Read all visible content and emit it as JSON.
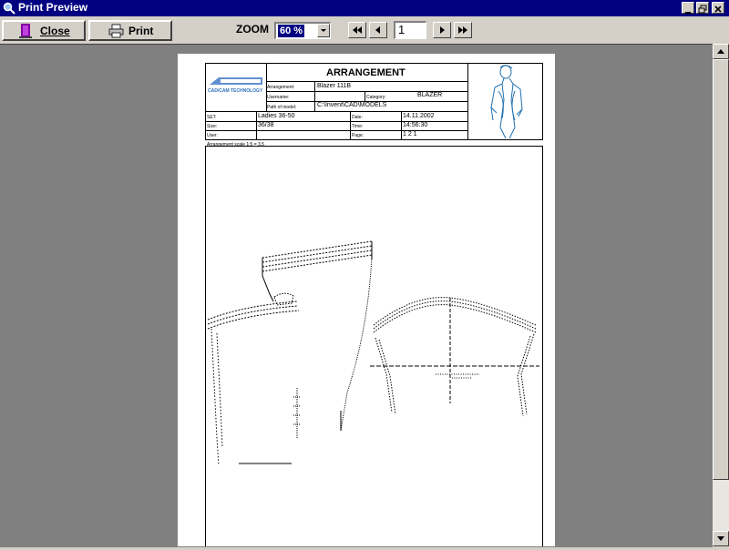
{
  "window": {
    "title": "Print Preview"
  },
  "toolbar": {
    "close_label": "Close",
    "print_label": "Print",
    "zoom_label": "ZOOM",
    "zoom_value": "60 %",
    "page_number": "1"
  },
  "document": {
    "heading": "ARRANGEMENT",
    "logo_text": "CAD/CAM TECHNOLOGY",
    "fields": {
      "arrangement_label": "Arrangement:",
      "arrangement_value": "Blazer 111B",
      "username_label": "Username:",
      "category_label": "Category:",
      "category_value": "BLAZER",
      "path_label": "Path of model:",
      "path_value": "C:\\Invent\\CAD\\MODELS",
      "set_label": "SET:",
      "set_value": "Ladies 36-50",
      "size_label": "Size:",
      "size_value": "36/38",
      "date_label": "Date:",
      "date_value": "14.11.2002",
      "time_label": "Time:",
      "time_value": "14:56:30",
      "user_label": "User:",
      "page_label": "Page:",
      "page_value": "1 2 1",
      "scale_note": "Arrangement scale 1:5 = 3.5"
    }
  }
}
